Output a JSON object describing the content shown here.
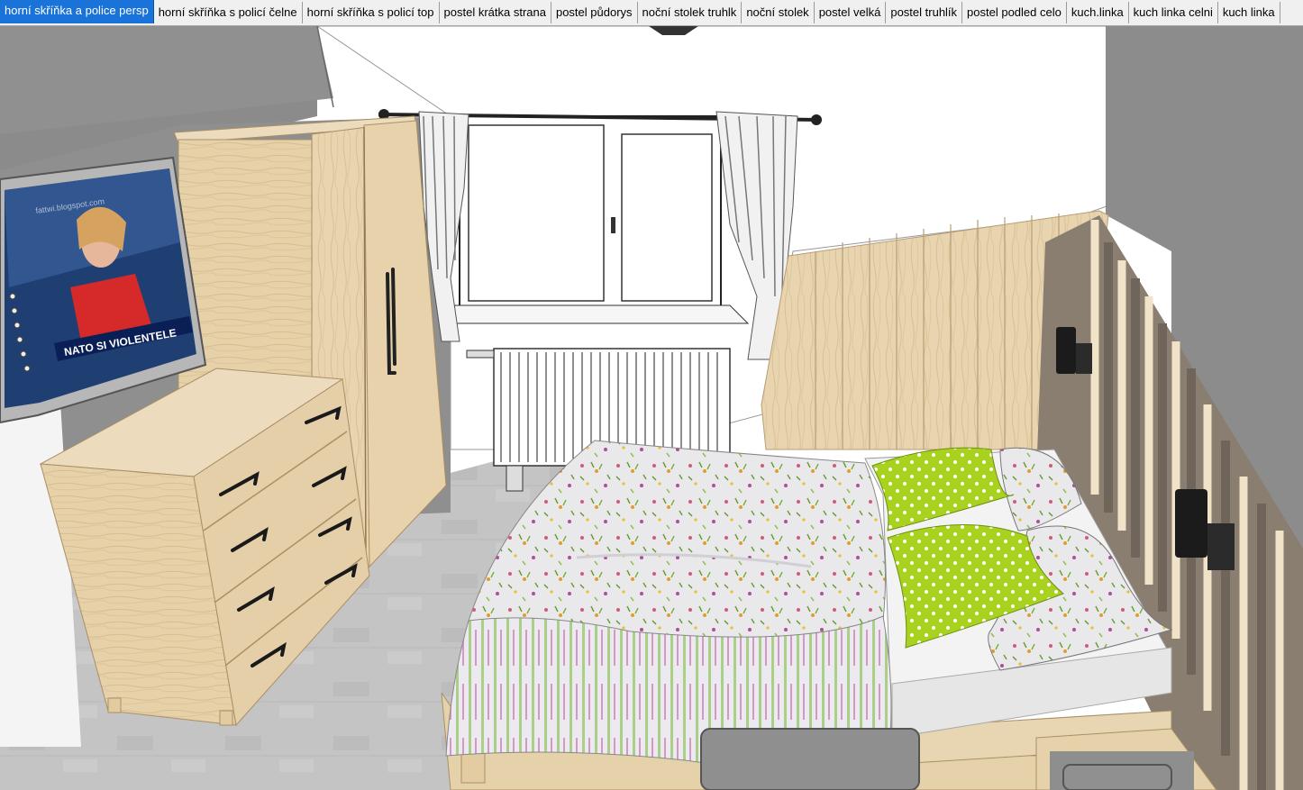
{
  "scene_tabs": [
    {
      "label": "horní skříňka a police persp",
      "active": true
    },
    {
      "label": "horní skříňka s policí čelne",
      "active": false
    },
    {
      "label": "horní skříňka s policí top",
      "active": false
    },
    {
      "label": "postel krátka strana",
      "active": false
    },
    {
      "label": "postel půdorys",
      "active": false
    },
    {
      "label": "noční stolek truhlk",
      "active": false
    },
    {
      "label": "noční stolek",
      "active": false
    },
    {
      "label": "postel velká",
      "active": false
    },
    {
      "label": "postel truhlík",
      "active": false
    },
    {
      "label": "postel podled celo",
      "active": false
    },
    {
      "label": "kuch.linka",
      "active": false
    },
    {
      "label": "kuch linka celni",
      "active": false
    },
    {
      "label": "kuch linka",
      "active": false
    }
  ],
  "tv": {
    "ticker_text": "NATO SI VIOLENTELE",
    "watermark_text": "fattwi.blogspot.com"
  },
  "colors": {
    "active_tab": "#1a73d9",
    "wood": "#e3cda5",
    "wall_grey": "#8e8e8e",
    "floor": "#c3c3c3",
    "pillow_green": "#a8d21e"
  }
}
